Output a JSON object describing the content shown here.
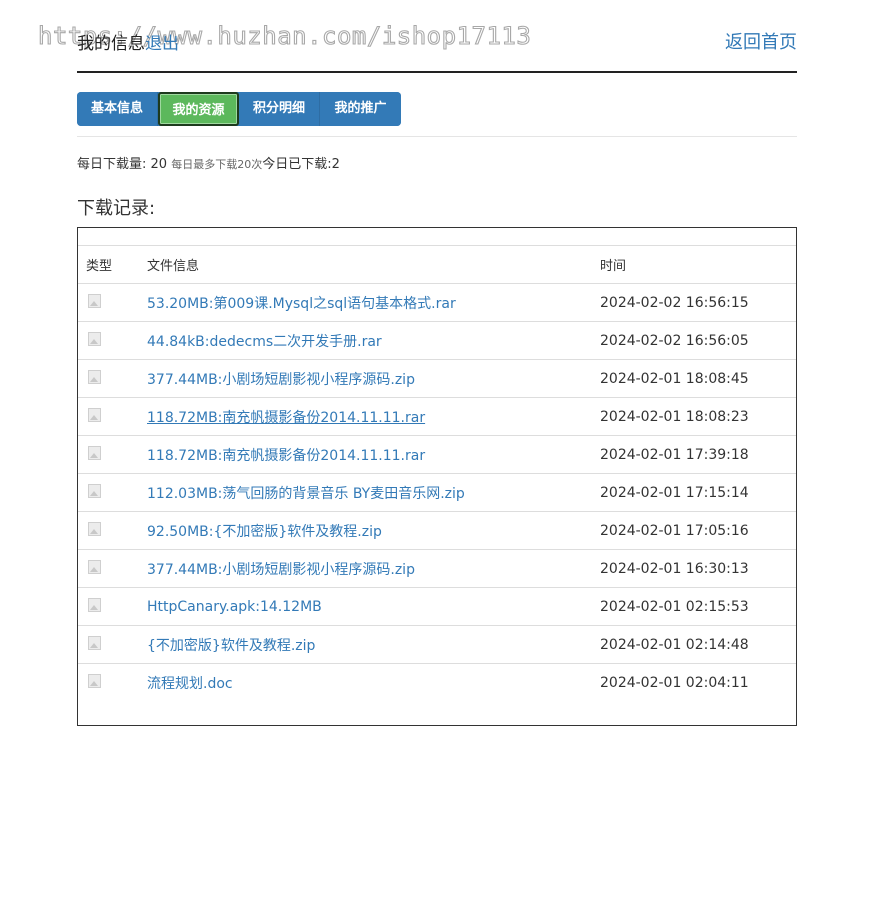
{
  "header": {
    "title": "我的信息",
    "logout": "退出",
    "home": "返回首页",
    "watermark": "https://www.huzhan.com/ishop17113"
  },
  "tabs": [
    {
      "label": "基本信息",
      "active": false
    },
    {
      "label": "我的资源",
      "active": true
    },
    {
      "label": "积分明细",
      "active": false
    },
    {
      "label": "我的推广",
      "active": false
    }
  ],
  "stats": {
    "daily_label": "每日下载量:",
    "daily_value": "20",
    "max_note": "每日最多下载20次",
    "today_label": "今日已下载:",
    "today_value": "2"
  },
  "section_title": "下载记录:",
  "table": {
    "headers": [
      "类型",
      "文件信息",
      "时间"
    ],
    "rows": [
      {
        "file": "53.20MB:第009课.Mysql之sql语句基本格式.rar",
        "time": "2024-02-02 16:56:15"
      },
      {
        "file": "44.84kB:dedecms二次开发手册.rar",
        "time": "2024-02-02 16:56:05"
      },
      {
        "file": "377.44MB:小剧场短剧影视小程序源码.zip",
        "time": "2024-02-01 18:08:45"
      },
      {
        "file": "118.72MB:南充帆摄影备份2014.11.11.rar",
        "time": "2024-02-01 18:08:23"
      },
      {
        "file": "118.72MB:南充帆摄影备份2014.11.11.rar",
        "time": "2024-02-01 17:39:18"
      },
      {
        "file": "112.03MB:荡气回肠的背景音乐 BY麦田音乐网.zip",
        "time": "2024-02-01 17:15:14"
      },
      {
        "file": "92.50MB:{不加密版}软件及教程.zip",
        "time": "2024-02-01 17:05:16"
      },
      {
        "file": "377.44MB:小剧场短剧影视小程序源码.zip",
        "time": "2024-02-01 16:30:13"
      },
      {
        "file": "HttpCanary.apk:14.12MB",
        "time": "2024-02-01 02:15:53"
      },
      {
        "file": "{不加密版}软件及教程.zip",
        "time": "2024-02-01 02:14:48"
      },
      {
        "file": "流程规划.doc",
        "time": "2024-02-01 02:04:11"
      }
    ]
  }
}
